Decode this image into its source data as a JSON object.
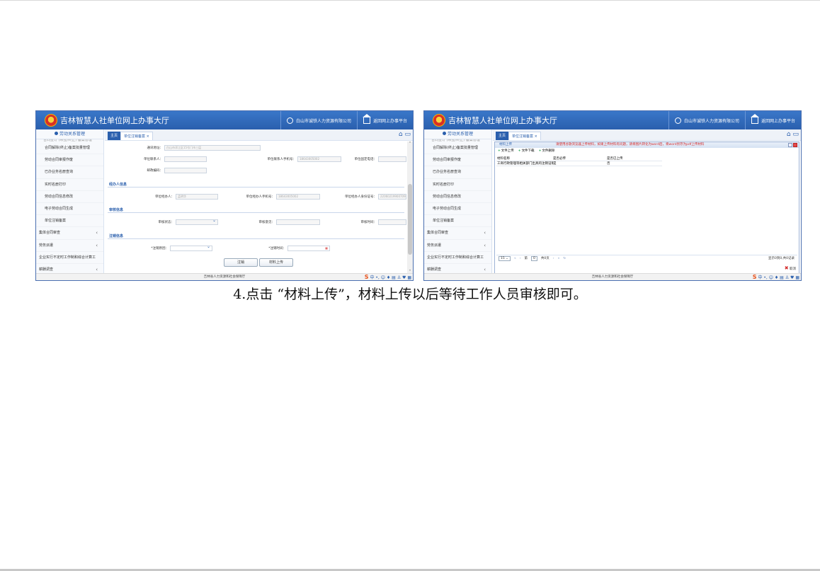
{
  "app": {
    "title": "吉林智慧人社单位网上办事大厅",
    "user": "白山市诚铁人力资源有限公司",
    "home_link": "返回网上办事平台",
    "footer": "吉林省人力资源和社会保障厅"
  },
  "sidebar": {
    "header": "劳动关系管理",
    "cut_item": "合同签订 (续签/终止) 备案管理",
    "items": [
      "合同解除(终止)备案批量管理",
      "劳动合同审报作废",
      "已办业务名册查询",
      "实时名册打印",
      "劳动合同信息修改",
      "电子劳动合同生成",
      "单位注销备案"
    ],
    "groups": [
      "集体合同审查",
      "劳务派遣",
      "企业实行不定时工作制和综合计算工",
      "薪酬调查"
    ]
  },
  "tabs": {
    "home": "主页",
    "active": "单位注销备案 ×"
  },
  "form": {
    "address_label": "通讯地址：",
    "address_value": "白山市浑江区15号门市三层",
    "contact_label": "单位联系人：",
    "contact_phone_label": "单位联系人手机号：",
    "contact_phone_value": "18643005002",
    "landline_label": "单位固定电话：",
    "postcode_label": "邮政编码：",
    "section_handler": "经办人信息",
    "handler_label": "单位经办人：",
    "handler_value": "孟明华",
    "handler_phone_label": "单位经办人手机号：",
    "handler_phone_value": "18643005002",
    "handler_id_label": "单位经办人身份证号：",
    "handler_id_value": "220602199007090016",
    "section_review": "审核信息",
    "review_status_label": "审核状态：",
    "review_opinion_label": "审核意见：",
    "review_time_label": "审核时间：",
    "section_cancel": "注销信息",
    "cancel_reason_label": "*注销原因：",
    "cancel_time_label": "*注销时间：",
    "cancel_button": "注销",
    "upload_button": "材料上传"
  },
  "upload": {
    "title": "材料上传",
    "warning": "请使用谷歌浏览器上传材料，如果上传材料有问题，请将图片转化为word后，将word另存为pdf上传材料",
    "tools": [
      "文件上传",
      "文件下载",
      "文件删除"
    ],
    "columns": [
      "材料名称",
      "是否必传",
      "是否已上传"
    ],
    "rows": [
      {
        "name": "工商行政管理等相关部门出具的注销证明",
        "required": "是",
        "uploaded": "否"
      }
    ],
    "pager": {
      "size": "15",
      "page_label": "第",
      "page_value": "0",
      "total": "共0页",
      "summary": "显示0到0,共0记录"
    },
    "cancel": "取消"
  },
  "caption": "4.点击 “材料上传”，材料上传以后等待工作人员审核即可。"
}
